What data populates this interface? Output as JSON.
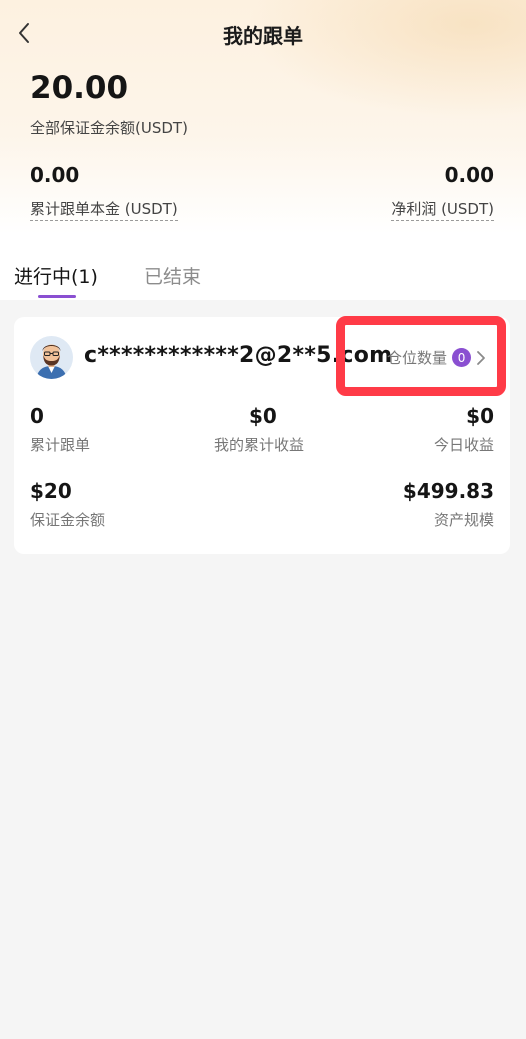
{
  "header": {
    "title": "我的跟单",
    "back_icon": "chevron-left-icon"
  },
  "summary": {
    "total_margin_balance": "20.00",
    "total_margin_balance_label": "全部保证金余额(USDT)",
    "cumulative_principal": "0.00",
    "cumulative_principal_label": "累计跟单本金 (USDT)",
    "net_profit": "0.00",
    "net_profit_label": "净利润 (USDT)"
  },
  "tabs": [
    {
      "label": "进行中(1)",
      "active": true
    },
    {
      "label": "已结束",
      "active": false
    }
  ],
  "card": {
    "email": "c************2@2**5.com",
    "position_label": "仓位数量",
    "position_count": "0",
    "stats": {
      "cumulative_orders": "0",
      "cumulative_orders_label": "累计跟单",
      "my_cumulative_income": "$0",
      "my_cumulative_income_label": "我的累计收益",
      "today_income": "$0",
      "today_income_label": "今日收益",
      "margin_balance": "$20",
      "margin_balance_label": "保证金余额",
      "asset_scale": "$499.83",
      "asset_scale_label": "资产规模"
    }
  },
  "colors": {
    "accent": "#8a4fd1",
    "highlight": "#ff3b47",
    "header_bg": "#fdf1e0",
    "page_bg": "#f5f5f5"
  }
}
